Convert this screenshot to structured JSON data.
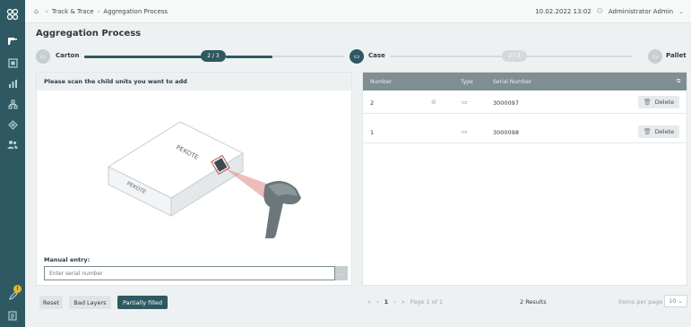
{
  "breadcrumb": {
    "items": [
      "Track & Trace",
      "Aggregation Process"
    ]
  },
  "header": {
    "datetime": "10.02.2022 13:02",
    "user": "Administrator Admin"
  },
  "page": {
    "title": "Aggregation Process"
  },
  "stepper": {
    "steps": [
      {
        "label": "Carton",
        "progress": "2 / 3"
      },
      {
        "label": "Case",
        "progress": "2 / 3"
      },
      {
        "label": "Pallet"
      }
    ]
  },
  "scan_panel": {
    "instruction": "Please scan the child units you want to add",
    "brand": "PEKOTE",
    "manual_label": "Manual entry:",
    "input_placeholder": "Enter serial number",
    "submit_label": "..."
  },
  "actions": {
    "reset": "Reset",
    "bad_layers": "Bad Layers",
    "partially_filled": "Partially filled"
  },
  "table": {
    "columns": {
      "number": "Number",
      "type": "Type",
      "serial": "Serial Number"
    },
    "rows": [
      {
        "number": "2",
        "serial": "3000097",
        "delete": "Delete"
      },
      {
        "number": "1",
        "serial": "3000098",
        "delete": "Delete"
      }
    ]
  },
  "pagination": {
    "current_page": "1",
    "page_info": "Page 1 of 1",
    "results": "2 Results",
    "items_per_page_label": "Items per page",
    "items_per_page": "10"
  },
  "colors": {
    "accent": "#2f5962",
    "sidebar": "#2f5962",
    "table_header": "#7f8e93"
  }
}
